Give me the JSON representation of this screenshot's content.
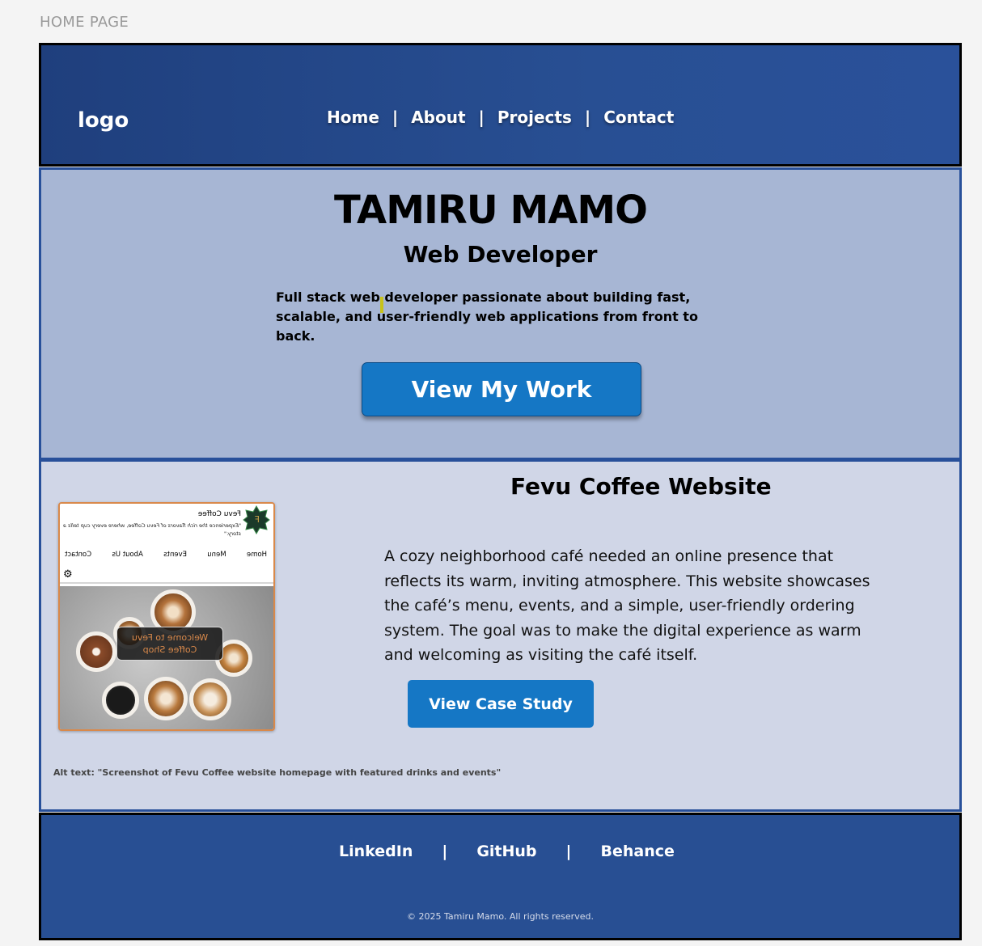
{
  "page_label": "HOME PAGE",
  "header": {
    "logo": "logo",
    "nav": [
      "Home",
      "About",
      "Projects",
      "Contact"
    ],
    "separator": "|"
  },
  "hero": {
    "name": "TAMIRU MAMO",
    "role": "Web Developer",
    "description": "Full stack web developer passionate about building fast, scalable, and user-friendly web applications from front to back.",
    "cta": "View My Work"
  },
  "project": {
    "title": "Fevu Coffee Website",
    "description": "A cozy neighborhood café needed an online presence that reflects its warm, inviting atmosphere. This website showcases the café’s menu, events, and a simple, user-friendly ordering system. The goal was to make the digital experience as warm and welcoming as visiting the café itself.",
    "cta": "View Case Study",
    "alt_text": "Alt text: \"Screenshot of Fevu Coffee website homepage with featured drinks and events\"",
    "thumbnail": {
      "brand": "Fevu Coffee",
      "tagline": "\"Experience the rich flavors of Fevu Coffee, where every cup tells a story.\"",
      "nav": [
        "Home",
        "Menu",
        "Events",
        "About Us",
        "Contact"
      ],
      "welcome_line1": "Welcome to Fevu",
      "welcome_line2": "Coffee Shop",
      "badge_letter": "F",
      "accent_color": "#d9894b"
    }
  },
  "footer": {
    "links": [
      "LinkedIn",
      "GitHub",
      "Behance"
    ],
    "separator": "|",
    "copyright": "© 2025  Tamiru Mamo. All rights reserved."
  },
  "colors": {
    "header_bg": "#284f93",
    "hero_bg": "#a7b6d4",
    "project_bg": "#d0d6e7",
    "button": "#1577c5"
  }
}
